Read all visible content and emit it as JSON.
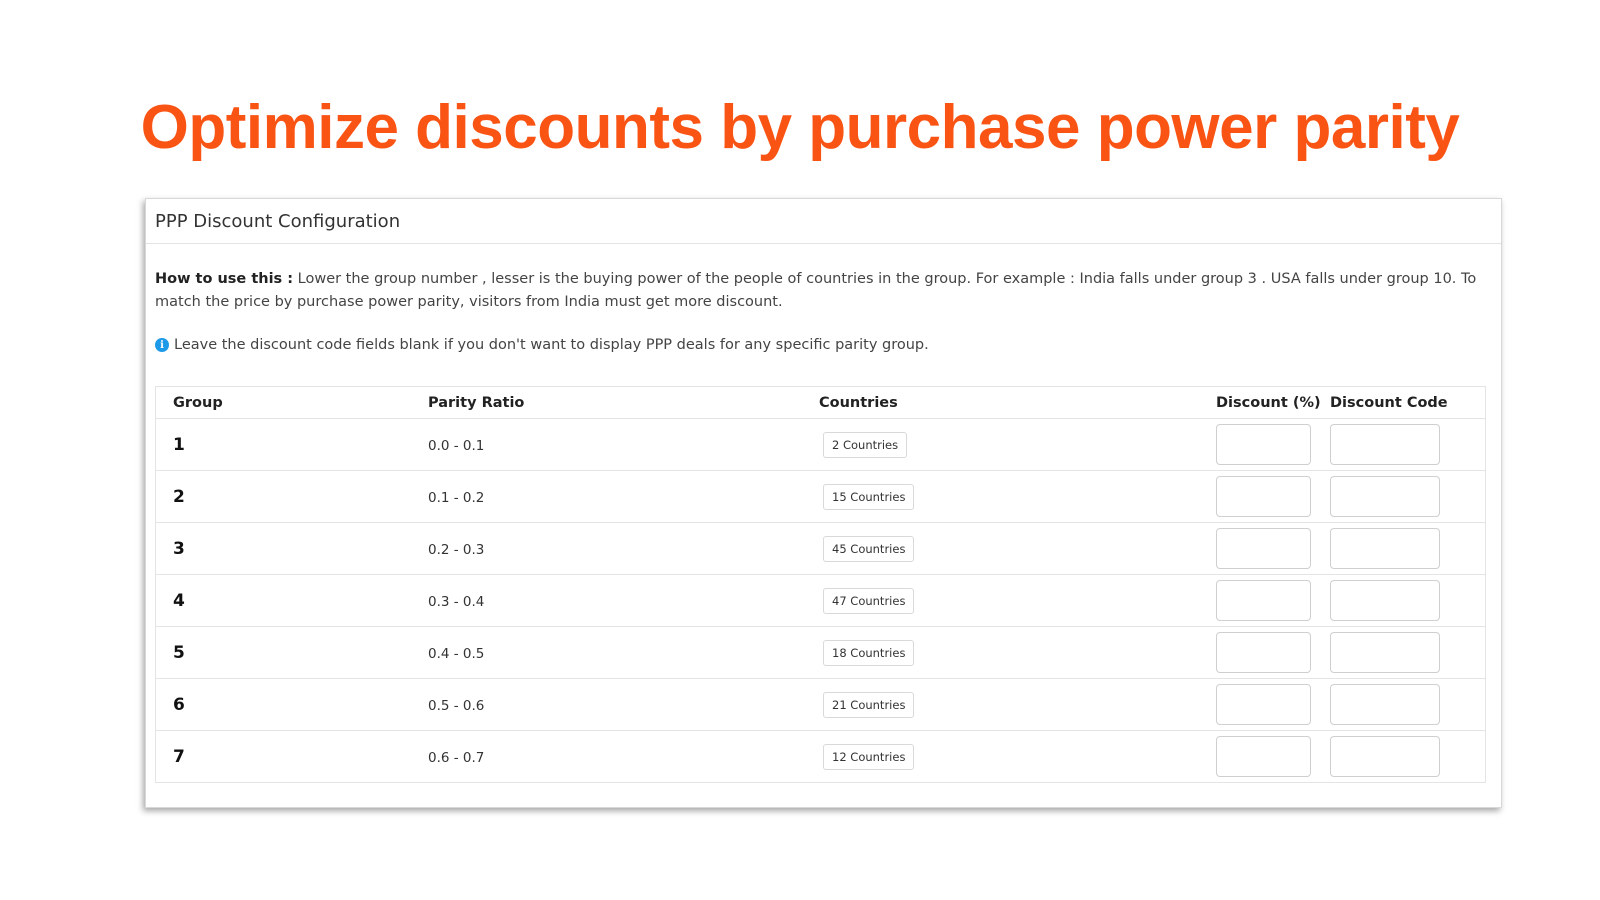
{
  "headline": "Optimize discounts by purchase power parity",
  "brand_color": "#fa5415",
  "panel": {
    "title": "PPP Discount Configuration",
    "howto_label": "How to use this :",
    "howto_text": " Lower the group number , lesser is the buying power of the people of countries in the group. For example : India falls under group 3 . USA falls under group 10. To match the price by purchase power parity, visitors from India must get more discount.",
    "info_icon": "info-icon",
    "info_color": "#1e9be8",
    "info_text": "Leave the discount code fields blank if you don't want to display PPP deals for any specific parity group."
  },
  "table": {
    "headers": {
      "group": "Group",
      "ratio": "Parity Ratio",
      "countries": "Countries",
      "discount": "Discount (%)",
      "code": "Discount Code"
    },
    "rows": [
      {
        "group": "1",
        "ratio": "0.0 - 0.1",
        "countries": "2 Countries",
        "discount": "",
        "code": ""
      },
      {
        "group": "2",
        "ratio": "0.1 - 0.2",
        "countries": "15 Countries",
        "discount": "",
        "code": ""
      },
      {
        "group": "3",
        "ratio": "0.2 - 0.3",
        "countries": "45 Countries",
        "discount": "",
        "code": ""
      },
      {
        "group": "4",
        "ratio": "0.3 - 0.4",
        "countries": "47 Countries",
        "discount": "",
        "code": ""
      },
      {
        "group": "5",
        "ratio": "0.4 - 0.5",
        "countries": "18 Countries",
        "discount": "",
        "code": ""
      },
      {
        "group": "6",
        "ratio": "0.5 - 0.6",
        "countries": "21 Countries",
        "discount": "",
        "code": ""
      },
      {
        "group": "7",
        "ratio": "0.6 - 0.7",
        "countries": "12 Countries",
        "discount": "",
        "code": ""
      }
    ]
  }
}
